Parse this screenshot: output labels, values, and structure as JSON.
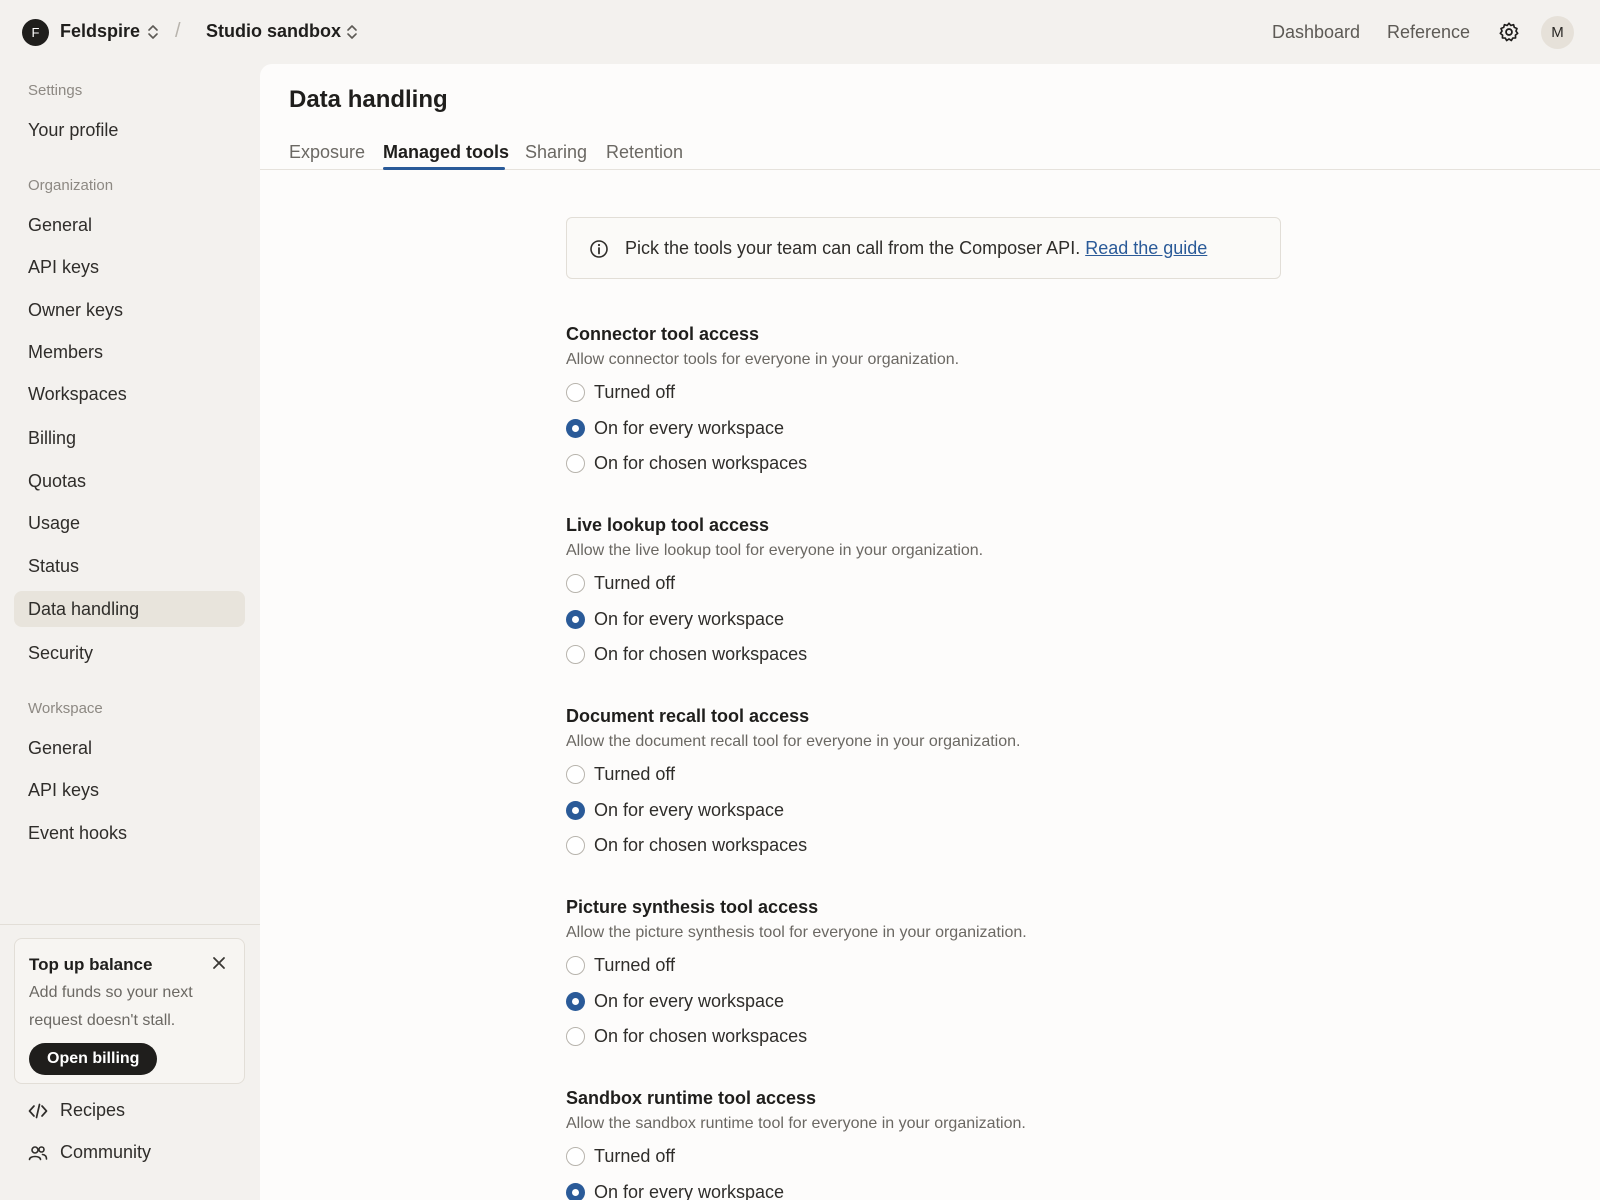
{
  "topbar": {
    "org_initial": "F",
    "org_name": "Feldspire",
    "separator": "/",
    "workspace_name": "Studio sandbox",
    "links": [
      "Dashboard",
      "Reference"
    ],
    "user_initial": "M"
  },
  "sidebar": {
    "groups": [
      {
        "heading": "Settings",
        "items": [
          "Your profile"
        ]
      },
      {
        "heading": "Organization",
        "items": [
          "General",
          "API keys",
          "Owner keys",
          "Members",
          "Workspaces",
          "Billing",
          "Quotas",
          "Usage",
          "Status",
          "Data handling",
          "Security"
        ]
      },
      {
        "heading": "Workspace",
        "items": [
          "General",
          "API keys",
          "Event hooks"
        ]
      }
    ],
    "active_item": "Data handling",
    "topup": {
      "title": "Top up balance",
      "description": "Add funds so your next request doesn't stall.",
      "button": "Open billing"
    },
    "bottom_links": [
      {
        "label": "Recipes",
        "icon": "code-icon"
      },
      {
        "label": "Community",
        "icon": "users-icon"
      }
    ]
  },
  "main": {
    "title": "Data handling",
    "tabs": [
      "Exposure",
      "Managed tools",
      "Sharing",
      "Retention"
    ],
    "active_tab": "Managed tools",
    "notice": {
      "text": "Pick the tools your team can call from the Composer API.",
      "link": "Read the guide"
    },
    "options": [
      "Turned off",
      "On for every workspace",
      "On for chosen workspaces"
    ],
    "sections": [
      {
        "title": "Connector tool access",
        "description": "Allow connector tools for everyone in your organization.",
        "selected": 1
      },
      {
        "title": "Live lookup tool access",
        "description": "Allow the live lookup tool for everyone in your organization.",
        "selected": 1
      },
      {
        "title": "Document recall tool access",
        "description": "Allow the document recall tool for everyone in your organization.",
        "selected": 1
      },
      {
        "title": "Picture synthesis tool access",
        "description": "Allow the picture synthesis tool for everyone in your organization.",
        "selected": 1
      },
      {
        "title": "Sandbox runtime tool access",
        "description": "Allow the sandbox runtime tool for everyone in your organization.",
        "selected": 1
      }
    ]
  },
  "colors": {
    "accent": "#2a5a98",
    "sidebar_bg": "#f3f1ee",
    "panel_bg": "#fdfcfb",
    "active_item_bg": "#e8e4dc"
  }
}
